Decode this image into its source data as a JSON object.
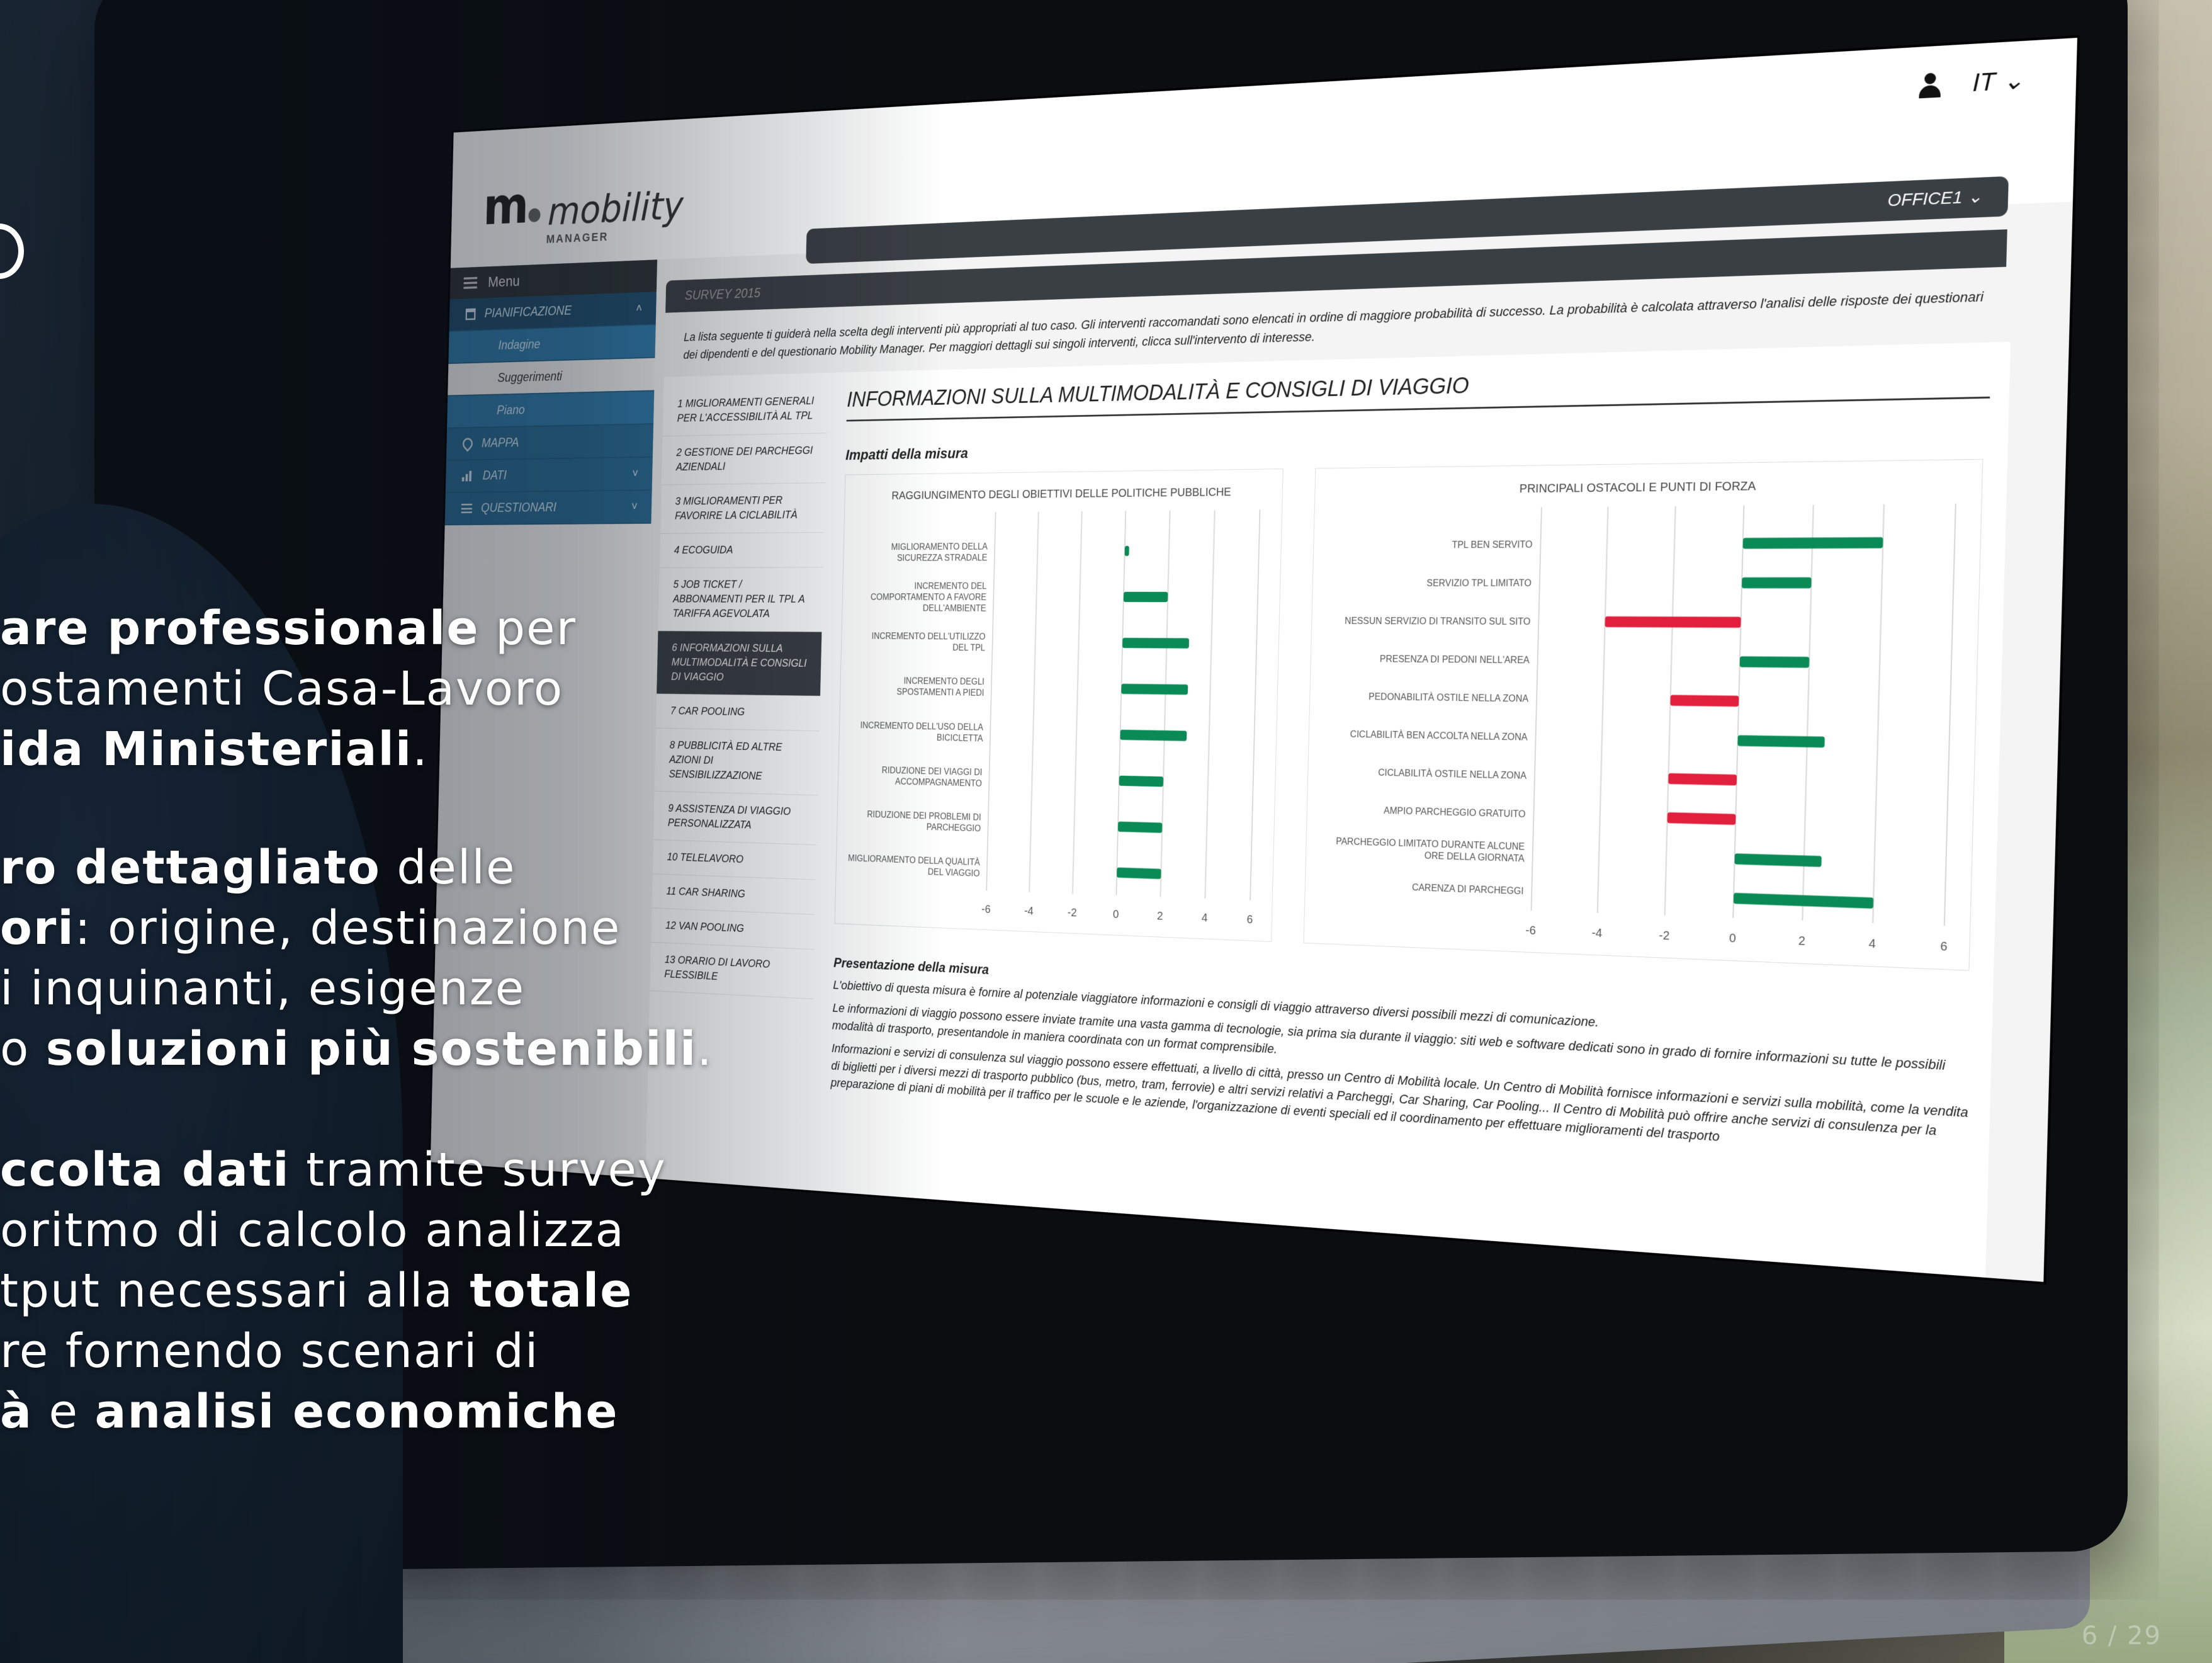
{
  "app": {
    "logo_text": "mobility",
    "logo_sub": "MANAGER",
    "language": "IT",
    "office": "OFFICE1"
  },
  "sidebar": {
    "menu_label": "Menu",
    "items": [
      {
        "label": "PIANIFICAZIONE",
        "icon": "calendar-icon"
      },
      {
        "label": "Indagine"
      },
      {
        "label": "Suggerimenti"
      },
      {
        "label": "Piano"
      },
      {
        "label": "MAPPA",
        "icon": "map-pin-icon"
      },
      {
        "label": "DATI",
        "icon": "bar-chart-icon"
      },
      {
        "label": "QUESTIONARI",
        "icon": "list-icon"
      }
    ]
  },
  "main": {
    "survey_tab": "SURVEY 2015",
    "intro": "La lista seguente ti guiderà nella scelta degli interventi più appropriati al tuo caso. Gli interventi raccomandati sono elencati in ordine di maggiore probabilità di successo. La probabilità è calcolata attraverso l'analisi delle risposte dei questionari dei dipendenti e del questionario Mobility Manager. Per maggiori dettagli sui singoli interventi, clicca sull'intervento di interesse.",
    "measures": [
      "1  MIGLIORAMENTI GENERALI PER L'ACCESSIBILITÀ AL TPL",
      "2  GESTIONE DEI PARCHEGGI AZIENDALI",
      "3  MIGLIORAMENTI PER FAVORIRE LA CICLABILITÀ",
      "4  ECOGUIDA",
      "5  JOB TICKET / ABBONAMENTI PER IL TPL A TARIFFA AGEVOLATA",
      "6  INFORMAZIONI SULLA MULTIMODALITÀ E CONSIGLI DI VIAGGIO",
      "7  CAR POOLING",
      "8  PUBBLICITÀ ED ALTRE AZIONI DI SENSIBILIZZAZIONE",
      "9  ASSISTENZA DI VIAGGIO PERSONALIZZATA",
      "10  TELELAVORO",
      "11  CAR SHARING",
      "12  VAN POOLING",
      "13  ORARIO DI LAVORO FLESSIBILE"
    ],
    "detail_title": "INFORMAZIONI SULLA MULTIMODALITÀ E CONSIGLI DI VIAGGIO",
    "impatti_label": "Impatti della misura",
    "presentazione_label": "Presentazione della misura",
    "paragraphs": [
      "L'obiettivo di questa misura è fornire al potenziale viaggiatore informazioni e consigli di viaggio attraverso diversi possibili mezzi di comunicazione.",
      "Le informazioni di viaggio possono essere inviate tramite una vasta gamma di tecnologie, sia prima sia durante il viaggio: siti web e software dedicati sono in grado di fornire informazioni su tutte le possibili modalità di trasporto, presentandole in maniera coordinata con un format comprensibile.",
      "Informazioni e servizi di consulenza sul viaggio possono essere effettuati, a livello di città, presso un Centro di Mobilità locale. Un Centro di Mobilità fornisce informazioni e servizi sulla mobilità, come la vendita di biglietti per i diversi mezzi di trasporto pubblico (bus, metro, tram, ferrovie) e altri servizi relativi a Parcheggi, Car Sharing, Car Pooling... Il Centro di Mobilità può offrire anche servizi di consulenza per la preparazione di piani di mobilità per il traffico per le scuole e le aziende, l'organizzazione di eventi speciali ed il coordinamento per effettuare miglioramenti del trasporto"
    ]
  },
  "chart_data": [
    {
      "type": "bar",
      "orientation": "horizontal",
      "title": "RAGGIUNGIMENTO DEGLI OBIETTIVI DELLE POLITICHE PUBBLICHE",
      "categories": [
        "MIGLIORAMENTO DELLA SICUREZZA STRADALE",
        "INCREMENTO DEL COMPORTAMENTO A FAVORE DELL'AMBIENTE",
        "INCREMENTO DELL'UTILIZZO DEL TPL",
        "INCREMENTO DEGLI SPOSTAMENTI A PIEDI",
        "INCREMENTO DELL'USO DELLA BICICLETTA",
        "RIDUZIONE DEI VIAGGI DI ACCOMPAGNAMENTO",
        "RIDUZIONE DEI PROBLEMI DI PARCHEGGIO",
        "MIGLIORAMENTO DELLA QUALITÀ DEL VIAGGIO"
      ],
      "values": [
        0.2,
        2,
        3,
        3,
        3,
        2,
        2,
        2
      ],
      "xlim": [
        -6,
        6
      ],
      "xticks": [
        -6,
        -4,
        -2,
        0,
        2,
        4,
        6
      ],
      "colors": {
        "positive": "#0a8a55",
        "negative": "#e0203c"
      }
    },
    {
      "type": "bar",
      "orientation": "horizontal",
      "title": "PRINCIPALI OSTACOLI E PUNTI DI FORZA",
      "categories": [
        "TPL BEN SERVITO",
        "SERVIZIO TPL LIMITATO",
        "NESSUN SERVIZIO DI TRANSITO SUL SITO",
        "PRESENZA DI PEDONI NELL'AREA",
        "PEDONABILITÀ OSTILE NELLA ZONA",
        "CICLABILITÀ BEN ACCOLTA NELLA ZONA",
        "CICLABILITÀ OSTILE NELLA ZONA",
        "AMPIO PARCHEGGIO GRATUITO",
        "PARCHEGGIO LIMITATO DURANTE ALCUNE ORE DELLA GIORNATA",
        "CARENZA DI PARCHEGGI"
      ],
      "values": [
        4,
        2,
        -4,
        2,
        -2,
        2.5,
        -2,
        -2,
        2.5,
        4
      ],
      "xlim": [
        -6,
        6
      ],
      "xticks": [
        -6,
        -4,
        -2,
        0,
        2,
        4,
        6
      ],
      "colors": {
        "positive": "#0a8a55",
        "negative": "#e0203c"
      }
    }
  ],
  "overlay": {
    "blocks": [
      [
        [
          {
            "t": "are professionale",
            "b": true
          },
          {
            "t": " per",
            "b": false
          }
        ],
        [
          {
            "t": "ostamenti Casa-Lavoro",
            "b": false
          }
        ],
        [
          {
            "t": "ida Ministeriali",
            "b": true
          },
          {
            "t": ".",
            "b": false
          }
        ]
      ],
      [
        [
          {
            "t": "ro dettagliato",
            "b": true
          },
          {
            "t": " delle",
            "b": false
          }
        ],
        [
          {
            "t": "ori",
            "b": true
          },
          {
            "t": ": origine, destinazione",
            "b": false
          }
        ],
        [
          {
            "t": "i inquinanti, esigenze",
            "b": false
          }
        ],
        [
          {
            "t": "o ",
            "b": false
          },
          {
            "t": "soluzioni più sostenibili",
            "b": true
          },
          {
            "t": ".",
            "b": false
          }
        ]
      ],
      [
        [
          {
            "t": "ccolta dati",
            "b": true
          },
          {
            "t": " tramite survey",
            "b": false
          }
        ],
        [
          {
            "t": "oritmo di calcolo analizza",
            "b": false
          }
        ],
        [
          {
            "t": "tput necessari alla ",
            "b": false
          },
          {
            "t": "totale",
            "b": true
          }
        ],
        [
          {
            "t": "re fornendo scenari di",
            "b": false
          }
        ],
        [
          {
            "t": "à",
            "b": true
          },
          {
            "t": " e ",
            "b": false
          },
          {
            "t": "analisi economiche",
            "b": true
          }
        ]
      ]
    ],
    "page_counter": "6 / 29"
  }
}
